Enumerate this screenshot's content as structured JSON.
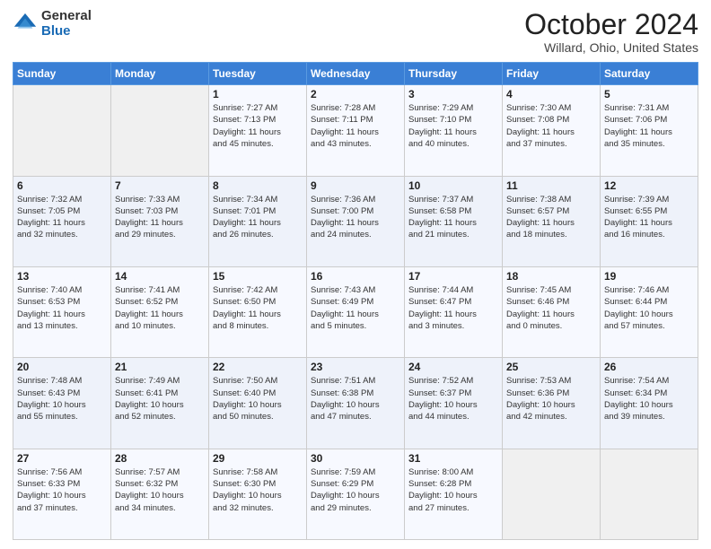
{
  "header": {
    "logo_general": "General",
    "logo_blue": "Blue",
    "month_title": "October 2024",
    "location": "Willard, Ohio, United States"
  },
  "calendar": {
    "days_of_week": [
      "Sunday",
      "Monday",
      "Tuesday",
      "Wednesday",
      "Thursday",
      "Friday",
      "Saturday"
    ],
    "weeks": [
      [
        {
          "day": "",
          "info": ""
        },
        {
          "day": "",
          "info": ""
        },
        {
          "day": "1",
          "info": "Sunrise: 7:27 AM\nSunset: 7:13 PM\nDaylight: 11 hours\nand 45 minutes."
        },
        {
          "day": "2",
          "info": "Sunrise: 7:28 AM\nSunset: 7:11 PM\nDaylight: 11 hours\nand 43 minutes."
        },
        {
          "day": "3",
          "info": "Sunrise: 7:29 AM\nSunset: 7:10 PM\nDaylight: 11 hours\nand 40 minutes."
        },
        {
          "day": "4",
          "info": "Sunrise: 7:30 AM\nSunset: 7:08 PM\nDaylight: 11 hours\nand 37 minutes."
        },
        {
          "day": "5",
          "info": "Sunrise: 7:31 AM\nSunset: 7:06 PM\nDaylight: 11 hours\nand 35 minutes."
        }
      ],
      [
        {
          "day": "6",
          "info": "Sunrise: 7:32 AM\nSunset: 7:05 PM\nDaylight: 11 hours\nand 32 minutes."
        },
        {
          "day": "7",
          "info": "Sunrise: 7:33 AM\nSunset: 7:03 PM\nDaylight: 11 hours\nand 29 minutes."
        },
        {
          "day": "8",
          "info": "Sunrise: 7:34 AM\nSunset: 7:01 PM\nDaylight: 11 hours\nand 26 minutes."
        },
        {
          "day": "9",
          "info": "Sunrise: 7:36 AM\nSunset: 7:00 PM\nDaylight: 11 hours\nand 24 minutes."
        },
        {
          "day": "10",
          "info": "Sunrise: 7:37 AM\nSunset: 6:58 PM\nDaylight: 11 hours\nand 21 minutes."
        },
        {
          "day": "11",
          "info": "Sunrise: 7:38 AM\nSunset: 6:57 PM\nDaylight: 11 hours\nand 18 minutes."
        },
        {
          "day": "12",
          "info": "Sunrise: 7:39 AM\nSunset: 6:55 PM\nDaylight: 11 hours\nand 16 minutes."
        }
      ],
      [
        {
          "day": "13",
          "info": "Sunrise: 7:40 AM\nSunset: 6:53 PM\nDaylight: 11 hours\nand 13 minutes."
        },
        {
          "day": "14",
          "info": "Sunrise: 7:41 AM\nSunset: 6:52 PM\nDaylight: 11 hours\nand 10 minutes."
        },
        {
          "day": "15",
          "info": "Sunrise: 7:42 AM\nSunset: 6:50 PM\nDaylight: 11 hours\nand 8 minutes."
        },
        {
          "day": "16",
          "info": "Sunrise: 7:43 AM\nSunset: 6:49 PM\nDaylight: 11 hours\nand 5 minutes."
        },
        {
          "day": "17",
          "info": "Sunrise: 7:44 AM\nSunset: 6:47 PM\nDaylight: 11 hours\nand 3 minutes."
        },
        {
          "day": "18",
          "info": "Sunrise: 7:45 AM\nSunset: 6:46 PM\nDaylight: 11 hours\nand 0 minutes."
        },
        {
          "day": "19",
          "info": "Sunrise: 7:46 AM\nSunset: 6:44 PM\nDaylight: 10 hours\nand 57 minutes."
        }
      ],
      [
        {
          "day": "20",
          "info": "Sunrise: 7:48 AM\nSunset: 6:43 PM\nDaylight: 10 hours\nand 55 minutes."
        },
        {
          "day": "21",
          "info": "Sunrise: 7:49 AM\nSunset: 6:41 PM\nDaylight: 10 hours\nand 52 minutes."
        },
        {
          "day": "22",
          "info": "Sunrise: 7:50 AM\nSunset: 6:40 PM\nDaylight: 10 hours\nand 50 minutes."
        },
        {
          "day": "23",
          "info": "Sunrise: 7:51 AM\nSunset: 6:38 PM\nDaylight: 10 hours\nand 47 minutes."
        },
        {
          "day": "24",
          "info": "Sunrise: 7:52 AM\nSunset: 6:37 PM\nDaylight: 10 hours\nand 44 minutes."
        },
        {
          "day": "25",
          "info": "Sunrise: 7:53 AM\nSunset: 6:36 PM\nDaylight: 10 hours\nand 42 minutes."
        },
        {
          "day": "26",
          "info": "Sunrise: 7:54 AM\nSunset: 6:34 PM\nDaylight: 10 hours\nand 39 minutes."
        }
      ],
      [
        {
          "day": "27",
          "info": "Sunrise: 7:56 AM\nSunset: 6:33 PM\nDaylight: 10 hours\nand 37 minutes."
        },
        {
          "day": "28",
          "info": "Sunrise: 7:57 AM\nSunset: 6:32 PM\nDaylight: 10 hours\nand 34 minutes."
        },
        {
          "day": "29",
          "info": "Sunrise: 7:58 AM\nSunset: 6:30 PM\nDaylight: 10 hours\nand 32 minutes."
        },
        {
          "day": "30",
          "info": "Sunrise: 7:59 AM\nSunset: 6:29 PM\nDaylight: 10 hours\nand 29 minutes."
        },
        {
          "day": "31",
          "info": "Sunrise: 8:00 AM\nSunset: 6:28 PM\nDaylight: 10 hours\nand 27 minutes."
        },
        {
          "day": "",
          "info": ""
        },
        {
          "day": "",
          "info": ""
        }
      ]
    ]
  }
}
